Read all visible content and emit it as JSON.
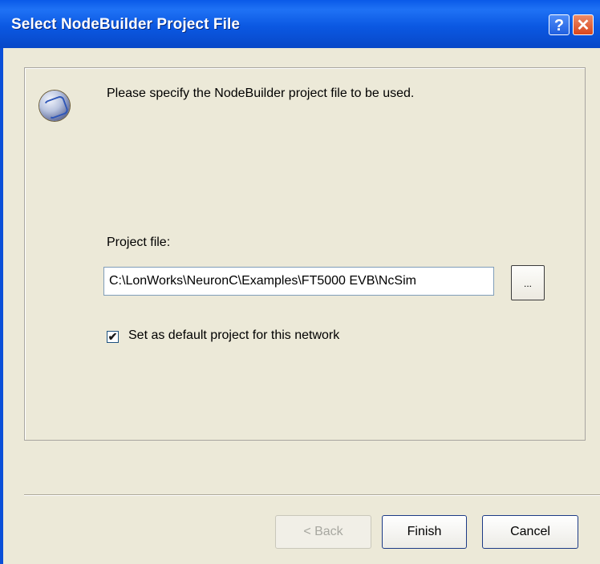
{
  "window": {
    "title": "Select NodeBuilder Project File",
    "help_label": "?",
    "close_label": "✕"
  },
  "content": {
    "instruction": "Please specify the NodeBuilder project file to be used.",
    "project_file_label": "Project file:",
    "project_file_value": "C:\\LonWorks\\NeuronC\\Examples\\FT5000 EVB\\NcSim",
    "browse_label": "...",
    "default_checkbox_label": "Set as default project for this network",
    "default_checked": true
  },
  "buttons": {
    "back": "< Back",
    "finish": "Finish",
    "cancel": "Cancel"
  },
  "icons": {
    "wizard": "nodebuilder-wizard-icon",
    "checkmark": "✔"
  }
}
